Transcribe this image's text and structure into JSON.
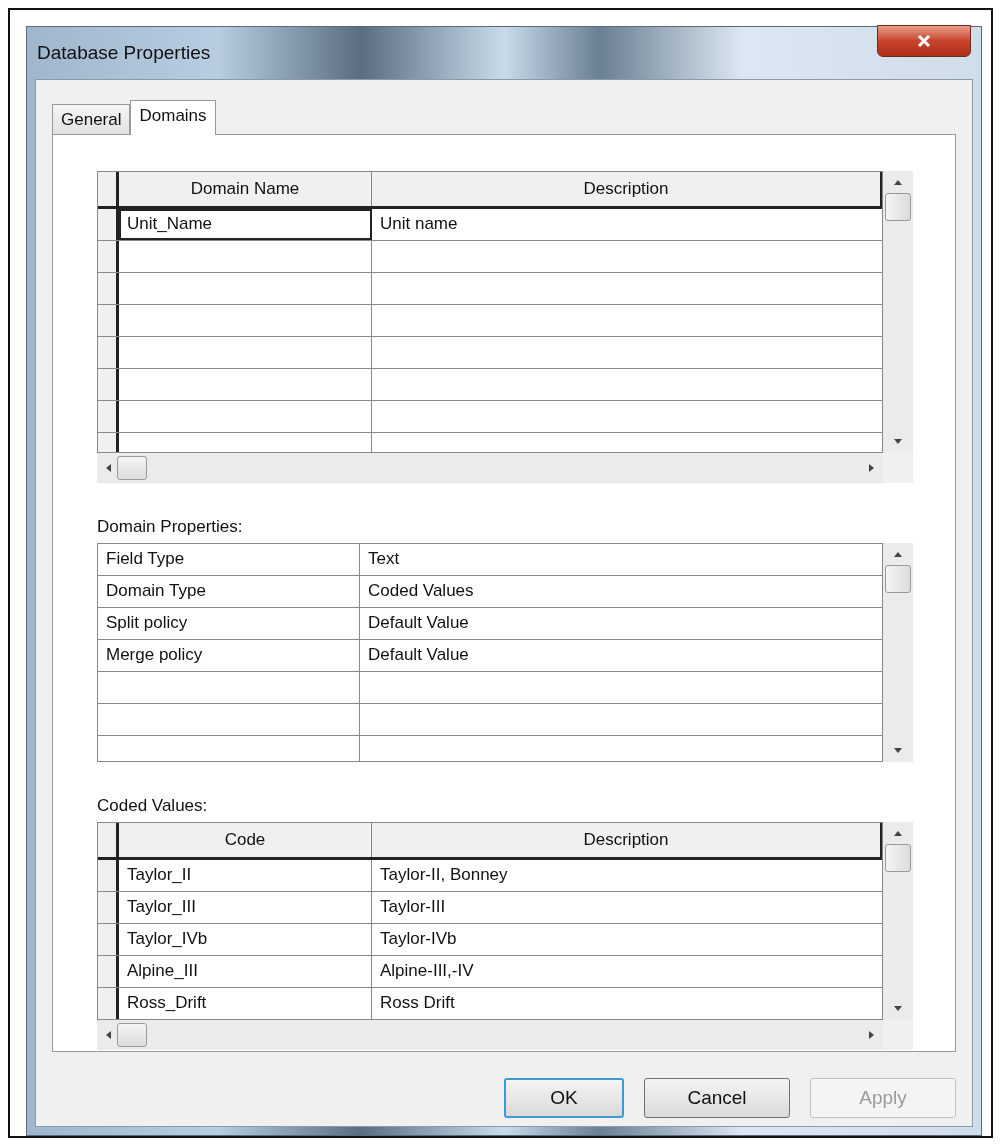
{
  "window": {
    "title": "Database Properties"
  },
  "tabs": [
    {
      "label": "General",
      "selected": false
    },
    {
      "label": "Domains",
      "selected": true
    }
  ],
  "domains_table": {
    "columns": [
      "Domain Name",
      "Description"
    ],
    "rows": [
      {
        "cells": [
          "Unit_Name",
          "Unit name"
        ],
        "selected": true
      }
    ]
  },
  "domain_properties": {
    "label": "Domain Properties:",
    "rows": [
      {
        "cells": [
          "Field Type",
          "Text"
        ]
      },
      {
        "cells": [
          "Domain Type",
          "Coded Values"
        ]
      },
      {
        "cells": [
          "Split policy",
          "Default Value"
        ]
      },
      {
        "cells": [
          "Merge policy",
          "Default Value"
        ]
      }
    ]
  },
  "coded_values": {
    "label": "Coded Values:",
    "columns": [
      "Code",
      "Description"
    ],
    "rows": [
      {
        "cells": [
          "Taylor_II",
          "Taylor-II, Bonney"
        ]
      },
      {
        "cells": [
          "Taylor_III",
          "Taylor-III"
        ]
      },
      {
        "cells": [
          "Taylor_IVb",
          "Taylor-IVb"
        ]
      },
      {
        "cells": [
          "Alpine_III",
          "Alpine-III,-IV"
        ]
      },
      {
        "cells": [
          "Ross_Drift",
          "Ross Drift"
        ]
      }
    ]
  },
  "buttons": [
    {
      "label": "OK",
      "default": true,
      "disabled": false
    },
    {
      "label": "Cancel",
      "default": false,
      "disabled": false
    },
    {
      "label": "Apply",
      "default": false,
      "disabled": true
    }
  ]
}
